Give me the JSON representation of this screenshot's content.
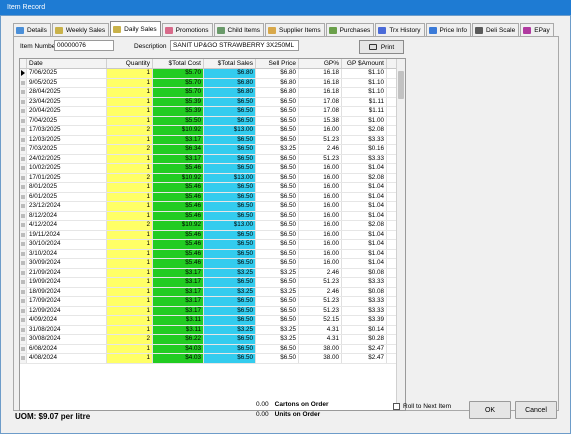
{
  "window": {
    "title": "Item Record"
  },
  "tabs": [
    {
      "label": "Details",
      "icon": "details-icon",
      "color": "#4a8fd8"
    },
    {
      "label": "Weekly Sales",
      "icon": "weekly-sales-icon",
      "color": "#c9b24a"
    },
    {
      "label": "Daily Sales",
      "icon": "daily-sales-icon",
      "color": "#c9b24a"
    },
    {
      "label": "Promotions",
      "icon": "promotions-icon",
      "color": "#d86a8a"
    },
    {
      "label": "Child Items",
      "icon": "child-items-icon",
      "color": "#6a9a6a"
    },
    {
      "label": "Supplier Items",
      "icon": "supplier-items-icon",
      "color": "#d8a84a"
    },
    {
      "label": "Purchases",
      "icon": "purchases-icon",
      "color": "#6aa04a"
    },
    {
      "label": "Trx History",
      "icon": "trx-history-icon",
      "color": "#4a6ad8"
    },
    {
      "label": "Price Info",
      "icon": "price-info-icon",
      "color": "#3a7ad8"
    },
    {
      "label": "Deli Scale",
      "icon": "deli-scale-icon",
      "color": "#5a5a5a"
    },
    {
      "label": "EPay",
      "icon": "epay-icon",
      "color": "#b03aa0"
    }
  ],
  "active_tab": "Daily Sales",
  "header": {
    "item_number_label": "Item Number",
    "item_number": "00000076",
    "description_label": "Description",
    "description": "SANIT UP&GO STRAWBERRY 3X250ML",
    "print_label": "Print"
  },
  "grid": {
    "columns": [
      "Date",
      "Quantity",
      "$Total Cost",
      "$Total Sales",
      "Sell Price",
      "GP%",
      "GP $Amount"
    ],
    "rows": [
      [
        "7/06/2025",
        "1",
        "$5.70",
        "$6.80",
        "$6.80",
        "16.18",
        "$1.10"
      ],
      [
        "9/05/2025",
        "1",
        "$5.70",
        "$6.80",
        "$6.80",
        "16.18",
        "$1.10"
      ],
      [
        "28/04/2025",
        "1",
        "$5.70",
        "$6.80",
        "$6.80",
        "16.18",
        "$1.10"
      ],
      [
        "23/04/2025",
        "1",
        "$5.39",
        "$6.50",
        "$6.50",
        "17.08",
        "$1.11"
      ],
      [
        "20/04/2025",
        "1",
        "$5.39",
        "$6.50",
        "$6.50",
        "17.08",
        "$1.11"
      ],
      [
        "7/04/2025",
        "1",
        "$5.50",
        "$6.50",
        "$6.50",
        "15.38",
        "$1.00"
      ],
      [
        "17/03/2025",
        "2",
        "$10.92",
        "$13.00",
        "$6.50",
        "16.00",
        "$2.08"
      ],
      [
        "12/03/2025",
        "1",
        "$3.17",
        "$6.50",
        "$6.50",
        "51.23",
        "$3.33"
      ],
      [
        "7/03/2025",
        "2",
        "$6.34",
        "$6.50",
        "$3.25",
        "2.46",
        "$0.16"
      ],
      [
        "24/02/2025",
        "1",
        "$3.17",
        "$6.50",
        "$6.50",
        "51.23",
        "$3.33"
      ],
      [
        "10/02/2025",
        "1",
        "$5.46",
        "$6.50",
        "$6.50",
        "16.00",
        "$1.04"
      ],
      [
        "17/01/2025",
        "2",
        "$10.92",
        "$13.00",
        "$6.50",
        "16.00",
        "$2.08"
      ],
      [
        "8/01/2025",
        "1",
        "$5.46",
        "$6.50",
        "$6.50",
        "16.00",
        "$1.04"
      ],
      [
        "6/01/2025",
        "1",
        "$5.46",
        "$6.50",
        "$6.50",
        "16.00",
        "$1.04"
      ],
      [
        "23/12/2024",
        "1",
        "$5.46",
        "$6.50",
        "$6.50",
        "16.00",
        "$1.04"
      ],
      [
        "8/12/2024",
        "1",
        "$5.46",
        "$6.50",
        "$6.50",
        "16.00",
        "$1.04"
      ],
      [
        "4/12/2024",
        "2",
        "$10.92",
        "$13.00",
        "$6.50",
        "16.00",
        "$2.08"
      ],
      [
        "19/11/2024",
        "1",
        "$5.46",
        "$6.50",
        "$6.50",
        "16.00",
        "$1.04"
      ],
      [
        "30/10/2024",
        "1",
        "$5.46",
        "$6.50",
        "$6.50",
        "16.00",
        "$1.04"
      ],
      [
        "3/10/2024",
        "1",
        "$5.46",
        "$6.50",
        "$6.50",
        "16.00",
        "$1.04"
      ],
      [
        "30/09/2024",
        "1",
        "$5.46",
        "$6.50",
        "$6.50",
        "16.00",
        "$1.04"
      ],
      [
        "21/09/2024",
        "1",
        "$3.17",
        "$3.25",
        "$3.25",
        "2.46",
        "$0.08"
      ],
      [
        "19/09/2024",
        "1",
        "$3.17",
        "$6.50",
        "$6.50",
        "51.23",
        "$3.33"
      ],
      [
        "18/09/2024",
        "1",
        "$3.17",
        "$3.25",
        "$3.25",
        "2.46",
        "$0.08"
      ],
      [
        "17/09/2024",
        "1",
        "$3.17",
        "$6.50",
        "$6.50",
        "51.23",
        "$3.33"
      ],
      [
        "12/09/2024",
        "1",
        "$3.17",
        "$6.50",
        "$6.50",
        "51.23",
        "$3.33"
      ],
      [
        "4/09/2024",
        "1",
        "$3.11",
        "$6.50",
        "$6.50",
        "52.15",
        "$3.39"
      ],
      [
        "31/08/2024",
        "1",
        "$3.11",
        "$3.25",
        "$3.25",
        "4.31",
        "$0.14"
      ],
      [
        "30/08/2024",
        "2",
        "$6.22",
        "$6.50",
        "$3.25",
        "4.31",
        "$0.28"
      ],
      [
        "6/08/2024",
        "1",
        "$4.03",
        "$6.50",
        "$6.50",
        "38.00",
        "$2.47"
      ],
      [
        "4/08/2024",
        "1",
        "$4.03",
        "$6.50",
        "$6.50",
        "38.00",
        "$2.47"
      ]
    ]
  },
  "footer": {
    "uom": "UOM:  $9.07 per litre",
    "cartons_value": "0.00",
    "cartons_label": "Cartons on Order",
    "units_value": "0.00",
    "units_label": "Units on Order",
    "roll_label": "Roll to Next Item",
    "ok_label": "OK",
    "cancel_label": "Cancel"
  }
}
